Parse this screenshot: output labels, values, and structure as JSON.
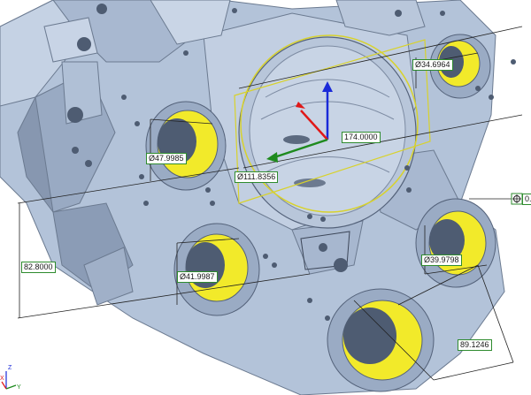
{
  "dimensions": {
    "dia_34": "Ø34.6964",
    "dia_111": "Ø111.8356",
    "len_174": "174.0000",
    "dia_47": "Ø47.9985",
    "len_82": "82.8000",
    "dia_41": "Ø41.9987",
    "dia_39": "Ø39.9798",
    "len_89": "89.1246",
    "datum_partial": "0."
  },
  "triad": {
    "z": "Z",
    "y": "Y",
    "x": "X"
  },
  "colors": {
    "part": "#b3c3d9",
    "part_dark": "#8797b0",
    "part_light": "#d4deec",
    "bore": "#f2ea2a",
    "dim_line": "#222222",
    "label_border": "#2e8b2e",
    "plane": "#d8d22c",
    "axis_x": "#e01818",
    "axis_y": "#1e8a1e",
    "axis_z": "#1a2ad8"
  }
}
